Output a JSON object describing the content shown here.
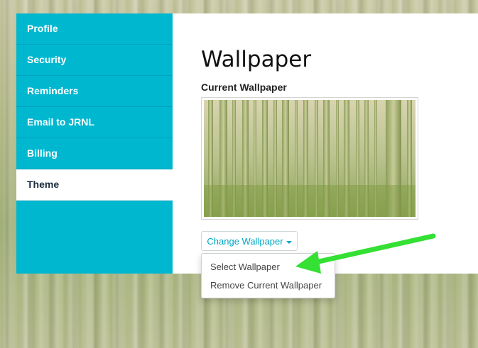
{
  "sidebar": {
    "items": [
      {
        "label": "Profile"
      },
      {
        "label": "Security"
      },
      {
        "label": "Reminders"
      },
      {
        "label": "Email to JRNL"
      },
      {
        "label": "Billing"
      },
      {
        "label": "Theme",
        "active": true
      }
    ]
  },
  "main": {
    "title": "Wallpaper",
    "current_label": "Current Wallpaper",
    "change_button": "Change Wallpaper",
    "menu": [
      {
        "label": "Select Wallpaper"
      },
      {
        "label": "Remove Current Wallpaper"
      }
    ]
  },
  "colors": {
    "accent": "#00b7d0",
    "arrow": "#33e033"
  },
  "icons": {
    "caret": "caret-down-icon",
    "annotation": "green-arrow-icon"
  }
}
